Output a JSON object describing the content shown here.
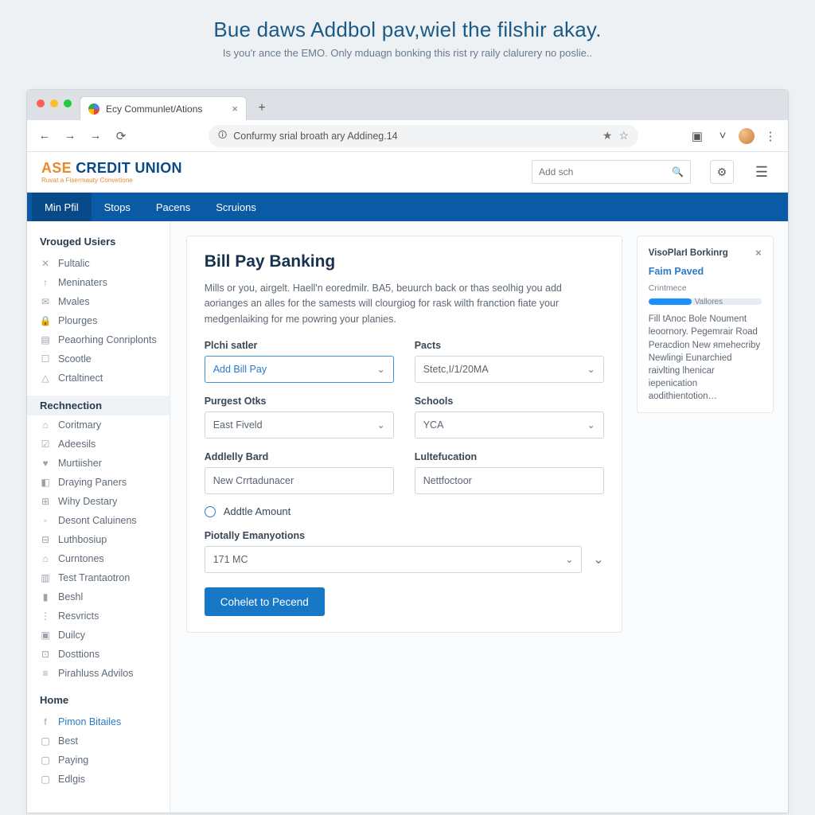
{
  "promo": {
    "title": "Bue daws Addbol pav,wiel the filshir akay.",
    "sub": "Is you'r ance the EMO. Only mduagn bonking this rist ry raily clalurery no poslie.."
  },
  "browser": {
    "tab_title": "Ecy Communlet/Ations",
    "url_text": "Confurmy srial broath ary Addineg.14"
  },
  "brand": {
    "logo_primary": "ASE",
    "logo_secondary": " CREDIT UNION",
    "logo_tag": "Ruvat a Fisermauty Convetione",
    "search_placeholder": "Add sch"
  },
  "primary_nav": [
    "Min Pfil",
    "Stops",
    "Pacens",
    "Scruions"
  ],
  "sidebar": {
    "group1_title": "Vrouged Usiers",
    "group1": [
      {
        "icon": "✕",
        "label": "Fultalic"
      },
      {
        "icon": "↑",
        "label": "Meninaters"
      },
      {
        "icon": "✉",
        "label": "Mvales"
      },
      {
        "icon": "🔒",
        "label": "Plourges"
      },
      {
        "icon": "▤",
        "label": "Peaorhing Conriplonts"
      },
      {
        "icon": "☐",
        "label": "Scootle"
      },
      {
        "icon": "△",
        "label": "Crtaltinect"
      }
    ],
    "group2_title": "Rechnection",
    "group2": [
      {
        "icon": "⌂",
        "label": "Coritmary"
      },
      {
        "icon": "☑",
        "label": "Adeesils"
      },
      {
        "icon": "♥",
        "label": "Murtiisher"
      },
      {
        "icon": "◧",
        "label": "Draying Paners"
      },
      {
        "icon": "⊞",
        "label": "Wihy Destary"
      },
      {
        "icon": "◦",
        "label": "Desont Caluinens"
      },
      {
        "icon": "⊟",
        "label": "Luthbosiup"
      },
      {
        "icon": "⌂",
        "label": "Curntones"
      },
      {
        "icon": "▥",
        "label": "Test Trantaotron"
      },
      {
        "icon": "▮",
        "label": "Beshl"
      },
      {
        "icon": "⋮",
        "label": "Resvricts"
      },
      {
        "icon": "▣",
        "label": "Duilcy"
      },
      {
        "icon": "⊡",
        "label": "Dosttions"
      },
      {
        "icon": "≡",
        "label": "Pirahluss Advilos"
      }
    ],
    "group3_title": "Home",
    "group3": [
      {
        "icon": "f",
        "label": "Pimon Bitailes",
        "link": true
      },
      {
        "icon": "▢",
        "label": "Best"
      },
      {
        "icon": "▢",
        "label": "Paying"
      },
      {
        "icon": "▢",
        "label": "Edlgis"
      }
    ]
  },
  "form": {
    "heading": "Bill Pay Banking",
    "desc": "Mills or you, airgelt. Haell'n eoredmilr. BA5, beuurch back or thas seolhig you add aorianges an alles for the samests will clourgiog for rask wilth franction fiate your medgenlaiking for me powring your planies.",
    "fields": {
      "f1_label": "Plchi satler",
      "f1_value": "Add Bill Pay",
      "f2_label": "Pacts",
      "f2_value": "Stetc,I/1/20MA",
      "f3_label": "Purgest Otks",
      "f3_value": "East Fiveld",
      "f4_label": "Schools",
      "f4_value": "YCA",
      "f5_label": "Addlelly Bard",
      "f5_value": "New Crrtadunacer",
      "f6_label": "Lultefucation",
      "f6_value": "Nettfoctoor",
      "radio_label": "Addtle Amount",
      "f7_label": "Piotally Emanyotions",
      "f7_value": "171 MC"
    },
    "submit_label": "Cohelet to Pecend"
  },
  "aside": {
    "title": "VisoPlarI Borkinrg",
    "link": "Faim Paved",
    "sub": "Crintmece",
    "progress_pct": 38,
    "progress_label": "Vallores",
    "body": "Fill tAnoс Bolе Noument leoornory. Pegemrair Road Peracdion New яmehecriby Newlingi Eunarchied raivlting lhenicar iepenication aodithientotion…"
  }
}
